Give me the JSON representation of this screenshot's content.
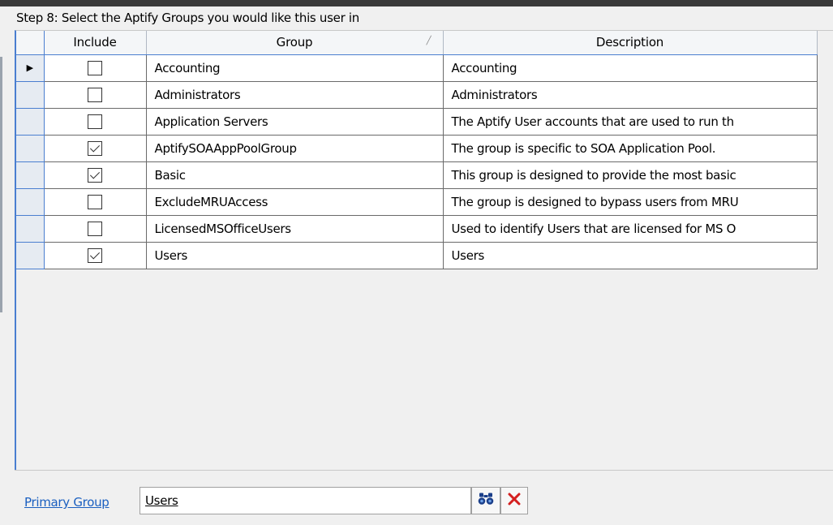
{
  "step_title": "Step 8: Select the Aptify Groups you would like this user in",
  "grid": {
    "columns": {
      "include": "Include",
      "group": "Group",
      "description": "Description"
    },
    "rows": [
      {
        "include": false,
        "group": "Accounting",
        "description": "Accounting",
        "current": true
      },
      {
        "include": false,
        "group": "Administrators",
        "description": "Administrators"
      },
      {
        "include": false,
        "group": "Application Servers",
        "description": "The Aptify User accounts that are used to run th"
      },
      {
        "include": true,
        "group": "AptifySOAAppPoolGroup",
        "description": "The group is specific to SOA Application Pool."
      },
      {
        "include": true,
        "group": "Basic",
        "description": "This group is designed to provide the most basic"
      },
      {
        "include": false,
        "group": "ExcludeMRUAccess",
        "description": "The group is designed to bypass users from MRU"
      },
      {
        "include": false,
        "group": "LicensedMSOfficeUsers",
        "description": "Used to identify Users that are licensed for MS O"
      },
      {
        "include": true,
        "group": "Users",
        "description": "Users"
      }
    ]
  },
  "primary_group": {
    "label": "Primary Group",
    "value": "Users"
  },
  "icons": {
    "current_row": "row-pointer-icon",
    "sort": "sort-indicator-icon",
    "find": "binoculars-icon",
    "clear": "red-x-icon"
  },
  "colors": {
    "accent": "#4a7ed0",
    "link": "#1a5fc0",
    "clear_icon": "#d42020",
    "find_icon": "#1b3f8a"
  }
}
